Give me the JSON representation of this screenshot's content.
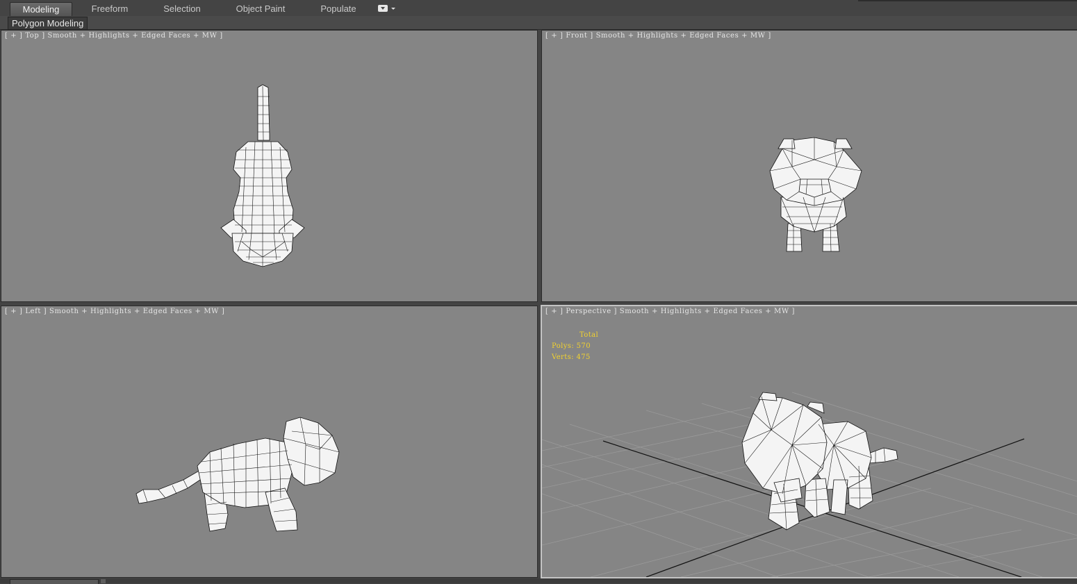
{
  "ribbon": {
    "tabs": [
      {
        "label": "Modeling",
        "active": true
      },
      {
        "label": "Freeform",
        "active": false
      },
      {
        "label": "Selection",
        "active": false
      },
      {
        "label": "Object Paint",
        "active": false
      },
      {
        "label": "Populate",
        "active": false
      }
    ],
    "options_icon": "dropdown-toggle-icon",
    "panel_label": "Polygon Modeling"
  },
  "viewports": {
    "top": {
      "label": "[ + ] Top ] Smooth + Highlights + Edged Faces + MW ]"
    },
    "front": {
      "label": "[ + ] Front ] Smooth + Highlights + Edged Faces + MW ]"
    },
    "left": {
      "label": "[ + ] Left ] Smooth + Highlights + Edged Faces + MW ]"
    },
    "perspective": {
      "label": "[ + ] Perspective ] Smooth + Highlights + Edged Faces + MW ]",
      "stats": {
        "total_label": "Total",
        "polys": "Polys: 570",
        "verts": "Verts: 475"
      }
    }
  },
  "colors": {
    "viewport_bg": "#858585",
    "stats_text": "#f2d22e",
    "active_border": "#c4c4c4",
    "mesh_fill": "#f4f4f4",
    "mesh_wire": "#111111"
  }
}
